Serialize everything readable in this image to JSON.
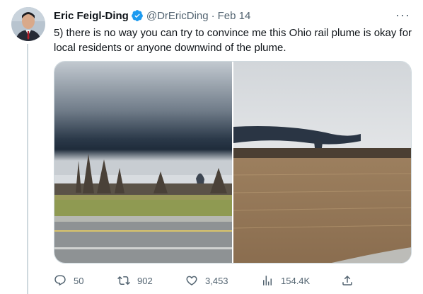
{
  "tweet": {
    "display_name": "Eric Feigl-Ding",
    "handle": "@DrEricDing",
    "separator": "·",
    "date": "Feb 14",
    "more_label": "···",
    "text": "5) there is no way you can try to convince me this Ohio rail plume is okay for local residents or anyone downwind of the plume."
  },
  "actions": {
    "replies": "50",
    "retweets": "902",
    "likes": "3,453",
    "views": "154.4K"
  },
  "colors": {
    "accent": "#1d9bf0",
    "muted": "#536471",
    "text": "#0f1419",
    "border": "#cfd9de"
  },
  "icons": {
    "verified": "verified-badge-icon",
    "more": "more-icon",
    "reply": "reply-icon",
    "retweet": "retweet-icon",
    "like": "like-icon",
    "views": "views-icon",
    "share": "share-icon"
  }
}
